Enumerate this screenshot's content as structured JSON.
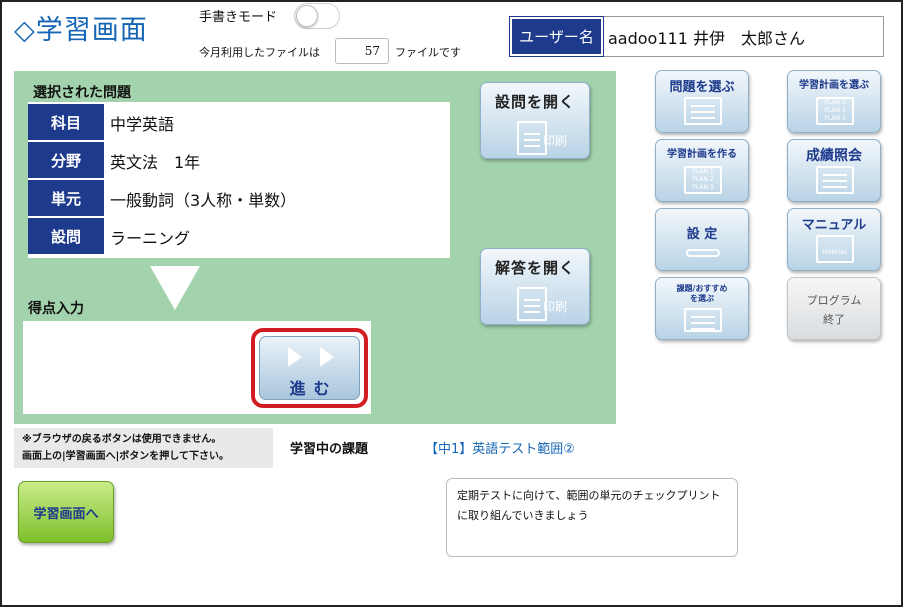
{
  "header": {
    "page_title": "◇学習画面",
    "handwriting_mode_label": "手書きモード",
    "handwriting_mode_on": false,
    "files_prefix": "今月利用したファイルは",
    "files_count": "57",
    "files_suffix": "ファイルです",
    "user_label": "ユーザー名",
    "user_name": "aadoo111 井伊　太郎さん"
  },
  "selected_problem": {
    "heading": "選択された問題",
    "rows": [
      {
        "label": "科目",
        "value": "中学英語"
      },
      {
        "label": "分野",
        "value": "英文法　1年"
      },
      {
        "label": "単元",
        "value": "一般動詞（3人称・単数）"
      },
      {
        "label": "設問",
        "value": "ラーニング"
      }
    ]
  },
  "score": {
    "heading": "得点入力",
    "next_label": "進む"
  },
  "actions": {
    "open_questions_label": "設問を開く",
    "open_answers_label": "解答を開く",
    "print_label": "印刷"
  },
  "side_menu": {
    "choose_problem": "問題を選ぶ",
    "choose_plan": "学習計画を選ぶ",
    "create_plan": "学習計画を作る",
    "grades": "成績照会",
    "settings": "設 定",
    "manual": "マニュアル",
    "manual_sub": "MANUAL",
    "recommend_line1": "課題/おすすめ",
    "recommend_line2": "を選ぶ",
    "exit_line1": "プログラム",
    "exit_line2": "終了",
    "plan_lines": [
      "PLAN 1",
      "PLAN 2",
      "PLAN 3"
    ]
  },
  "bottom": {
    "note_line1": "※ブラウザの戻るボタンは使用できません。",
    "note_line2": "画面上の|学習画面へ|ボタンを押して下さい。",
    "task_heading": "学習中の課題",
    "task_value": "【中1】英語テスト範囲②",
    "study_home_label": "学習画面へ",
    "comment": "定期テストに向けて、範囲の単元のチェックプリントに取り組んでいきましょう"
  },
  "colors": {
    "accent_blue": "#1565b5",
    "navy": "#1e3a8c",
    "panel_green": "#a3d3ad",
    "highlight_red": "#d31b24",
    "home_green": "#7dbf2a"
  }
}
